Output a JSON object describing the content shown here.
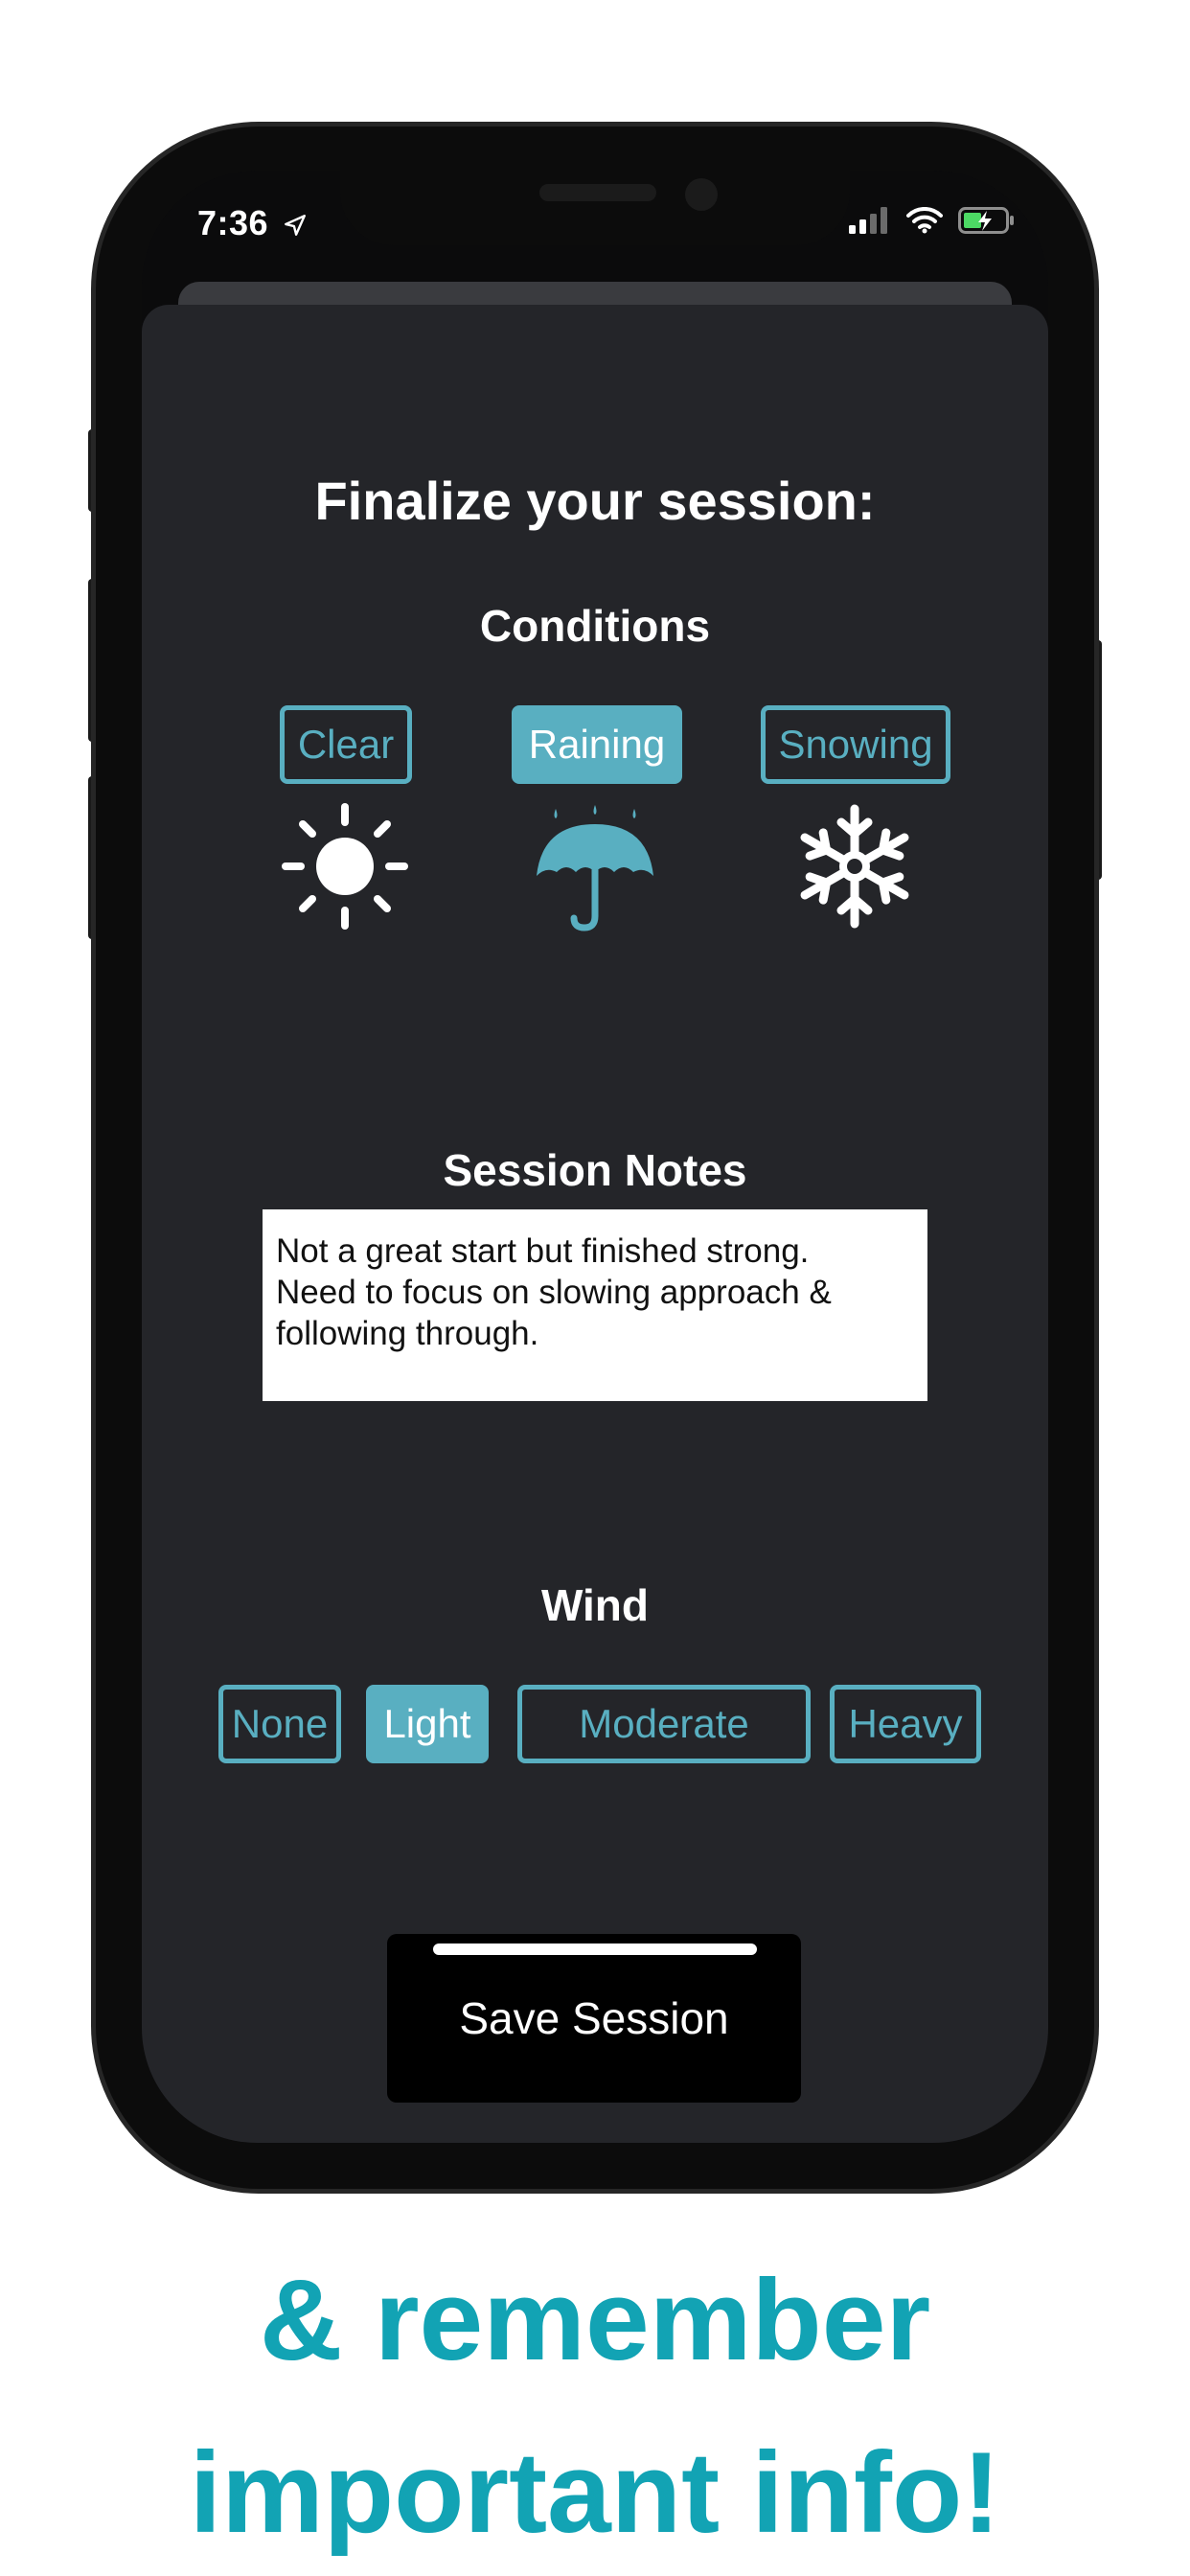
{
  "status_bar": {
    "time": "7:36"
  },
  "sheet": {
    "title": "Finalize your session:"
  },
  "conditions": {
    "heading": "Conditions",
    "options": [
      {
        "label": "Clear",
        "icon": "sun-icon",
        "selected": false
      },
      {
        "label": "Raining",
        "icon": "umbrella-icon",
        "selected": true
      },
      {
        "label": "Snowing",
        "icon": "snowflake-icon",
        "selected": false
      }
    ]
  },
  "notes": {
    "heading": "Session Notes",
    "value": "Not a great start but finished strong.\nNeed to focus on slowing approach &\nfollowing through."
  },
  "wind": {
    "heading": "Wind",
    "options": [
      {
        "label": "None",
        "selected": false
      },
      {
        "label": "Light",
        "selected": true
      },
      {
        "label": "Moderate",
        "selected": false
      },
      {
        "label": "Heavy",
        "selected": false
      }
    ]
  },
  "save_button": {
    "label": "Save Session"
  },
  "tagline": {
    "line1": "& remember",
    "line2": "important info!"
  },
  "colors": {
    "accent": "#59afc1",
    "tagline": "#12a3b4",
    "sheet_bg": "#242529"
  }
}
